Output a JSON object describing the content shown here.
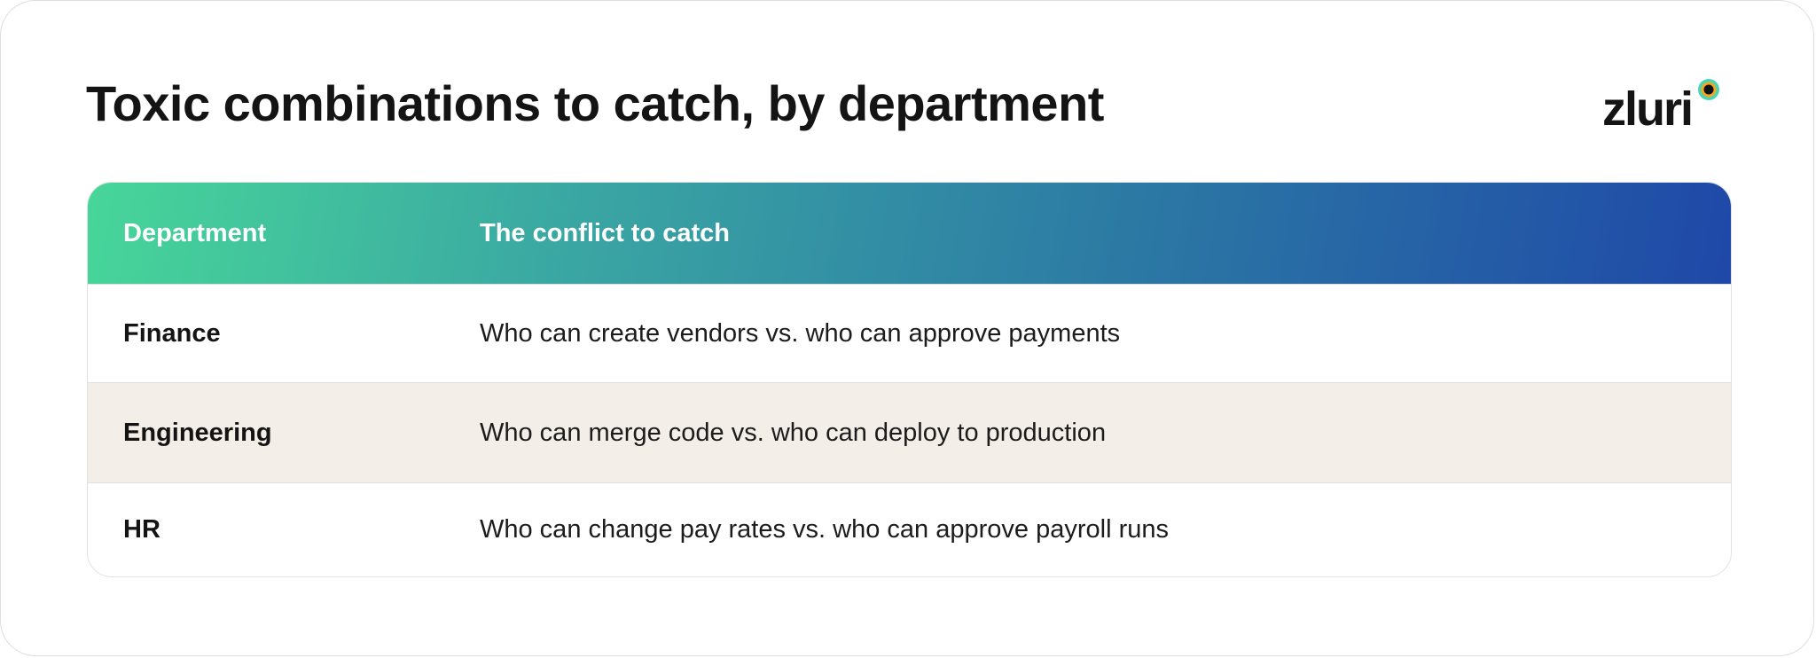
{
  "title": "Toxic combinations to catch, by department",
  "brand": {
    "logo_text": "zluri",
    "icon": "zluri-logo-icon",
    "colors": {
      "dot_outer": "#46d6b4",
      "dot_mid": "#f5a623",
      "dot_inner": "#111111"
    }
  },
  "table": {
    "headers": {
      "department": "Department",
      "conflict": "The conflict to catch"
    },
    "header_gradient": [
      "#47d699",
      "#1f48a8"
    ],
    "rows": [
      {
        "department": "Finance",
        "conflict": "Who can create vendors vs. who can approve payments"
      },
      {
        "department": "Engineering",
        "conflict": "Who can merge code vs. who can deploy to production"
      },
      {
        "department": "HR",
        "conflict": "Who can change pay rates vs. who can approve payroll runs"
      }
    ],
    "alt_row_color": "#f3efe8"
  }
}
